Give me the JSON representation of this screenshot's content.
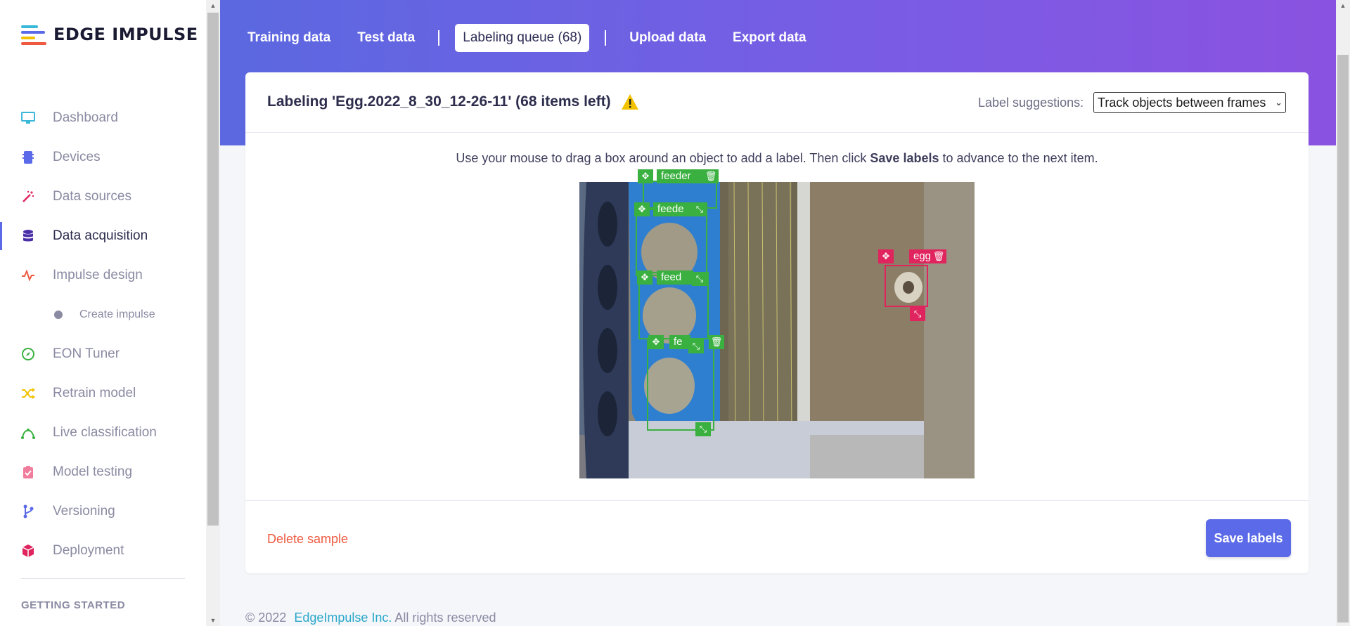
{
  "brand": {
    "name": "EDGE IMPULSE"
  },
  "sidebar": {
    "items": [
      {
        "label": "Dashboard",
        "icon": "monitor-icon",
        "color": "#3ab8d9"
      },
      {
        "label": "Devices",
        "icon": "chip-icon",
        "color": "#5a6ae8"
      },
      {
        "label": "Data sources",
        "icon": "wand-icon",
        "color": "#e0245e"
      },
      {
        "label": "Data acquisition",
        "icon": "database-icon",
        "color": "#4a2ea8",
        "active": true
      },
      {
        "label": "Impulse design",
        "icon": "pulse-icon",
        "color": "#ee5a3f"
      },
      {
        "label": "Create impulse",
        "icon": "dot-icon",
        "sub": true
      },
      {
        "label": "EON Tuner",
        "icon": "compass-icon",
        "color": "#3ab040"
      },
      {
        "label": "Retrain model",
        "icon": "shuffle-icon",
        "color": "#f2c200"
      },
      {
        "label": "Live classification",
        "icon": "curve-icon",
        "color": "#3ab040"
      },
      {
        "label": "Model testing",
        "icon": "clipboard-icon",
        "color": "#f07d9b"
      },
      {
        "label": "Versioning",
        "icon": "branch-icon",
        "color": "#5a6ae8"
      },
      {
        "label": "Deployment",
        "icon": "box-icon",
        "color": "#e0245e"
      }
    ],
    "section_heading": "GETTING STARTED"
  },
  "tabs": [
    {
      "label": "Training data"
    },
    {
      "label": "Test data"
    },
    {
      "label": "Labeling queue (68)",
      "active": true
    },
    {
      "label": "Upload data"
    },
    {
      "label": "Export data"
    }
  ],
  "card": {
    "title": "Labeling 'Egg.2022_8_30_12-26-11' (68 items left)",
    "suggest_label": "Label suggestions:",
    "suggest_value": "Track objects between frames",
    "instructions_pre": "Use your mouse to drag a box around an object to add a label. Then click ",
    "instructions_bold": "Save labels",
    "instructions_post": " to advance to the next item.",
    "labels": {
      "feeder_1": "feeder",
      "feeder_2": "feede",
      "feeder_3": "feed",
      "feeder_4": "fe",
      "egg": "egg"
    },
    "delete_label": "Delete sample",
    "save_label": "Save labels"
  },
  "footer": {
    "copyright": "© 2022",
    "company": "EdgeImpulse Inc.",
    "rights": "All rights reserved"
  },
  "colors": {
    "accent": "#5a6ae8",
    "label_green": "#3ab040",
    "label_red": "#e0245e",
    "danger_text": "#ee5a3f",
    "warning": "#f2c200"
  }
}
